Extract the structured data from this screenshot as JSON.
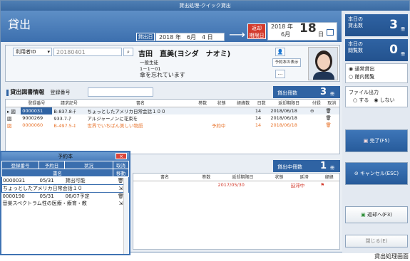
{
  "window_title": "貸出処理-クイック貸出",
  "header": {
    "app_title": "貸出",
    "loan_date_label": "貸出日",
    "loan_date_value": "2018 年　6月　4 日",
    "due_label": "返却\n期限日",
    "due_year": "2018 年",
    "due_month": "6月",
    "due_day": "18",
    "due_day_unit": "日"
  },
  "stats": [
    {
      "label": "本日の\n貸出数",
      "value": "3",
      "unit": "冊"
    },
    {
      "label": "本日の\n閲覧数",
      "value": "0",
      "unit": "冊"
    }
  ],
  "mode_options": [
    "◉ 通常貸出",
    "○ 館内閲覧"
  ],
  "file_output": {
    "label": "ファイル出力",
    "options": "○ する　◉ しない"
  },
  "buttons": {
    "complete": "完了(F5)",
    "cancel": "キャンセル(ESC)",
    "return": "返却へ(F3)",
    "close": "閉じる(E)"
  },
  "user": {
    "id_select": "利用者ID",
    "id_value": "20180401",
    "name": "吉田　直美(ヨシダ　ナオミ)",
    "type": "一般生徒",
    "class": "1－1－01",
    "memo": "傘を忘れています",
    "reserve_btn": "予約本の表示",
    "more_btn": "..."
  },
  "loan_section": {
    "title": "貸出図書情報",
    "reg_label": "登録番号",
    "count_label": "貸出冊数",
    "count_value": "3",
    "count_unit": "冊",
    "headers": [
      "",
      "登録番号",
      "請求記号",
      "書名",
      "巻数",
      "状態",
      "経緯数",
      "日数",
      "返却期限日",
      "付録",
      "取消"
    ],
    "rows": [
      {
        "mark": "▸ 図",
        "reg": "0000031",
        "call": "B-837.8-ﾁ",
        "title": "ちょっとしたアメリカ日常会話１００",
        "vol": "",
        "state": "",
        "hist": "",
        "days": "14",
        "due": "2018/06/18",
        "extra": "⊖",
        "cancel": "🗑",
        "color": "#222"
      },
      {
        "mark": "図",
        "reg": "9000269",
        "call": "933.7-ｱ",
        "title": "アルジャーノンに花束を",
        "vol": "",
        "state": "",
        "hist": "",
        "days": "14",
        "due": "2018/06/18",
        "extra": "",
        "cancel": "🗑",
        "color": "#222"
      },
      {
        "mark": "図",
        "reg": "0000060",
        "call": "B-497.5-ｷ",
        "title": "世界でいちばん美しい物語",
        "vol": "",
        "state": "予約中",
        "hist": "",
        "days": "14",
        "due": "2018/06/18",
        "extra": "",
        "cancel": "🗑",
        "color": "#e8742c"
      }
    ]
  },
  "borrowed_section": {
    "count_label": "貸出中冊数",
    "count_value": "1",
    "count_unit": "冊",
    "headers": [
      "書名",
      "巻数",
      "返却期限日",
      "状態",
      "延滞",
      "経緯"
    ],
    "row": {
      "title": "",
      "vol": "",
      "due": "2017/05/30",
      "state": "",
      "overdue": "延滞中"
    }
  },
  "popup": {
    "title": "予約本",
    "close": "×",
    "headers1": [
      "登録番号",
      "予約日",
      "状況",
      "取消"
    ],
    "headers2": [
      "書名",
      "移動"
    ],
    "rows": [
      {
        "reg": "0000031",
        "date": "05/31",
        "status": "貸出可能",
        "title": "ちょっとしたアメリカ日常会話１０",
        "selected": true
      },
      {
        "reg": "0000190",
        "date": "05/31",
        "status": "06/07予定",
        "title": "音楽スペクトラム性の医療・療育・教",
        "selected": false
      }
    ]
  },
  "caption": "貸出処理画面"
}
